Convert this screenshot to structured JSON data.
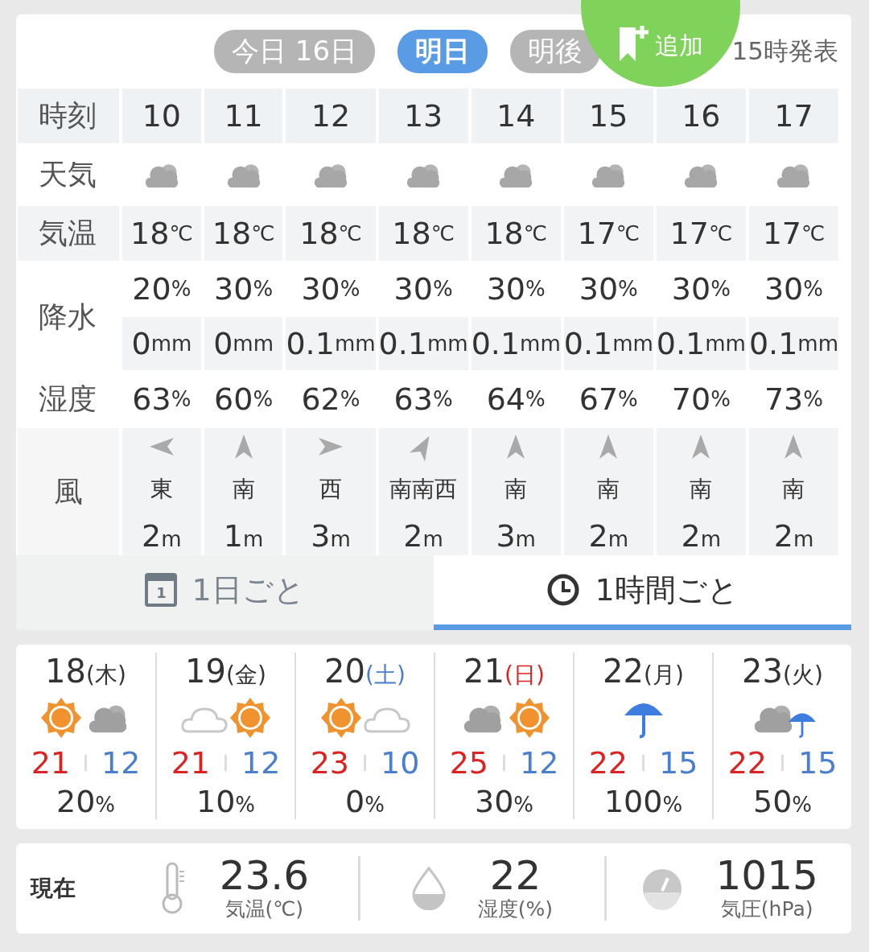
{
  "header": {
    "day_tabs": [
      {
        "label": "今日 16日",
        "selected": false
      },
      {
        "label": "明日",
        "selected": true
      },
      {
        "label": "明後",
        "selected": false
      }
    ],
    "add_button": {
      "label": "追加"
    },
    "issued": "15時発表"
  },
  "hourly": {
    "labels": {
      "time": "時刻",
      "weather": "天気",
      "temp": "気温",
      "precip": "降水",
      "humidity": "湿度",
      "wind": "風"
    },
    "hours": [
      {
        "time": "10",
        "weather": {
          "kind": "cloud"
        },
        "temp": "18",
        "temp_unit": "℃",
        "prob": "20",
        "prob_unit": "%",
        "amount": "0",
        "amount_unit": "mm",
        "humidity": "63",
        "humidity_unit": "%",
        "arrow": {
          "kind": "left"
        },
        "direction": "東",
        "speed": "2",
        "speed_unit": "m"
      },
      {
        "time": "11",
        "weather": {
          "kind": "cloud"
        },
        "temp": "18",
        "temp_unit": "℃",
        "prob": "30",
        "prob_unit": "%",
        "amount": "0",
        "amount_unit": "mm",
        "humidity": "60",
        "humidity_unit": "%",
        "arrow": {
          "kind": "up"
        },
        "direction": "南",
        "speed": "1",
        "speed_unit": "m"
      },
      {
        "time": "12",
        "weather": {
          "kind": "cloud"
        },
        "temp": "18",
        "temp_unit": "℃",
        "prob": "30",
        "prob_unit": "%",
        "amount": "0.1",
        "amount_unit": "mm",
        "humidity": "62",
        "humidity_unit": "%",
        "arrow": {
          "kind": "right"
        },
        "direction": "西",
        "speed": "3",
        "speed_unit": "m"
      },
      {
        "time": "13",
        "weather": {
          "kind": "cloud"
        },
        "temp": "18",
        "temp_unit": "℃",
        "prob": "30",
        "prob_unit": "%",
        "amount": "0.1",
        "amount_unit": "mm",
        "humidity": "63",
        "humidity_unit": "%",
        "arrow": {
          "kind": "up-right"
        },
        "direction": "南南西",
        "speed": "2",
        "speed_unit": "m"
      },
      {
        "time": "14",
        "weather": {
          "kind": "cloud"
        },
        "temp": "18",
        "temp_unit": "℃",
        "prob": "30",
        "prob_unit": "%",
        "amount": "0.1",
        "amount_unit": "mm",
        "humidity": "64",
        "humidity_unit": "%",
        "arrow": {
          "kind": "up"
        },
        "direction": "南",
        "speed": "3",
        "speed_unit": "m"
      },
      {
        "time": "15",
        "weather": {
          "kind": "cloud"
        },
        "temp": "17",
        "temp_unit": "℃",
        "prob": "30",
        "prob_unit": "%",
        "amount": "0.1",
        "amount_unit": "mm",
        "humidity": "67",
        "humidity_unit": "%",
        "arrow": {
          "kind": "up"
        },
        "direction": "南",
        "speed": "2",
        "speed_unit": "m"
      },
      {
        "time": "16",
        "weather": {
          "kind": "cloud"
        },
        "temp": "17",
        "temp_unit": "℃",
        "prob": "30",
        "prob_unit": "%",
        "amount": "0.1",
        "amount_unit": "mm",
        "humidity": "70",
        "humidity_unit": "%",
        "arrow": {
          "kind": "up"
        },
        "direction": "南",
        "speed": "2",
        "speed_unit": "m"
      },
      {
        "time": "17",
        "weather": {
          "kind": "cloud"
        },
        "temp": "17",
        "temp_unit": "℃",
        "prob": "30",
        "prob_unit": "%",
        "amount": "0.1",
        "amount_unit": "mm",
        "humidity": "73",
        "humidity_unit": "%",
        "arrow": {
          "kind": "up"
        },
        "direction": "南",
        "speed": "2",
        "speed_unit": "m"
      }
    ]
  },
  "view_tabs": [
    {
      "label": "1日ごと",
      "kind": "calendar",
      "icon_text": "1",
      "selected": false
    },
    {
      "label": "1時間ごと",
      "kind": "clock",
      "selected": true
    }
  ],
  "daily": [
    {
      "date": "18",
      "weekday": {
        "text": "(木)",
        "color": "#333333"
      },
      "icons": [
        {
          "kind": "sun"
        },
        {
          "kind": "cloud"
        }
      ],
      "high": "21",
      "low": "12",
      "prob": "20",
      "prob_unit": "%"
    },
    {
      "date": "19",
      "weekday": {
        "text": "(金)",
        "color": "#333333"
      },
      "icons": [
        {
          "kind": "cloud-light"
        },
        {
          "kind": "sun"
        }
      ],
      "high": "21",
      "low": "12",
      "prob": "10",
      "prob_unit": "%"
    },
    {
      "date": "20",
      "weekday": {
        "text": "(土)",
        "color": "#4a7fd0"
      },
      "icons": [
        {
          "kind": "sun"
        },
        {
          "kind": "cloud-light"
        }
      ],
      "high": "23",
      "low": "10",
      "prob": "0",
      "prob_unit": "%"
    },
    {
      "date": "21",
      "weekday": {
        "text": "(日)",
        "color": "#dd2222"
      },
      "icons": [
        {
          "kind": "cloud"
        },
        {
          "kind": "sun"
        }
      ],
      "high": "25",
      "low": "12",
      "prob": "30",
      "prob_unit": "%"
    },
    {
      "date": "22",
      "weekday": {
        "text": "(月)",
        "color": "#333333"
      },
      "icons": [
        {
          "kind": "umbrella"
        }
      ],
      "high": "22",
      "low": "15",
      "prob": "100",
      "prob_unit": "%"
    },
    {
      "date": "23",
      "weekday": {
        "text": "(火)",
        "color": "#333333"
      },
      "icons": [
        {
          "kind": "cloud"
        },
        {
          "kind": "umbrella-small"
        }
      ],
      "high": "22",
      "low": "15",
      "prob": "50",
      "prob_unit": "%"
    }
  ],
  "current": {
    "label": "現在",
    "items": [
      {
        "kind": "thermometer",
        "value": "23.6",
        "caption": "気温(℃)"
      },
      {
        "kind": "drop",
        "value": "22",
        "caption": "湿度(%)"
      },
      {
        "kind": "gauge",
        "value": "1015",
        "caption": "気圧(hPa)"
      }
    ]
  }
}
